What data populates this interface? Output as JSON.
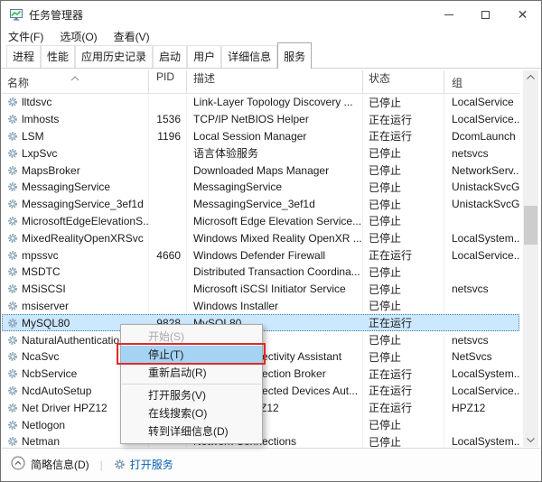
{
  "window": {
    "title": "任务管理器"
  },
  "titlebar_controls": {
    "minimize": "最小化",
    "maximize": "最大化",
    "close": "关闭"
  },
  "menubar": {
    "items": [
      {
        "name": "file",
        "label": "文件(F)"
      },
      {
        "name": "options",
        "label": "选项(O)"
      },
      {
        "name": "view",
        "label": "查看(V)"
      }
    ]
  },
  "tabs": {
    "items": [
      {
        "name": "processes",
        "label": "进程",
        "active": false
      },
      {
        "name": "performance",
        "label": "性能",
        "active": false
      },
      {
        "name": "app-history",
        "label": "应用历史记录",
        "active": false
      },
      {
        "name": "startup",
        "label": "启动",
        "active": false
      },
      {
        "name": "users",
        "label": "用户",
        "active": false
      },
      {
        "name": "details",
        "label": "详细信息",
        "active": false
      },
      {
        "name": "services",
        "label": "服务",
        "active": true
      }
    ]
  },
  "table": {
    "columns": {
      "name": "名称",
      "pid": "PID",
      "desc": "描述",
      "status": "状态",
      "group": "组"
    },
    "rows": [
      {
        "name": "lltdsvc",
        "pid": "",
        "desc": "Link-Layer Topology Discovery ...",
        "status": "已停止",
        "group": "LocalService",
        "selected": false
      },
      {
        "name": "lmhosts",
        "pid": "1536",
        "desc": "TCP/IP NetBIOS Helper",
        "status": "正在运行",
        "group": "LocalService...",
        "selected": false
      },
      {
        "name": "LSM",
        "pid": "1196",
        "desc": "Local Session Manager",
        "status": "正在运行",
        "group": "DcomLaunch",
        "selected": false
      },
      {
        "name": "LxpSvc",
        "pid": "",
        "desc": "语言体验服务",
        "status": "已停止",
        "group": "netsvcs",
        "selected": false
      },
      {
        "name": "MapsBroker",
        "pid": "",
        "desc": "Downloaded Maps Manager",
        "status": "已停止",
        "group": "NetworkServ...",
        "selected": false
      },
      {
        "name": "MessagingService",
        "pid": "",
        "desc": "MessagingService",
        "status": "已停止",
        "group": "UnistackSvcG...",
        "selected": false
      },
      {
        "name": "MessagingService_3ef1d",
        "pid": "",
        "desc": "MessagingService_3ef1d",
        "status": "已停止",
        "group": "UnistackSvcG...",
        "selected": false
      },
      {
        "name": "MicrosoftEdgeElevationS...",
        "pid": "",
        "desc": "Microsoft Edge Elevation Service...",
        "status": "已停止",
        "group": "",
        "selected": false
      },
      {
        "name": "MixedRealityOpenXRSvc",
        "pid": "",
        "desc": "Windows Mixed Reality OpenXR ...",
        "status": "已停止",
        "group": "LocalSystem...",
        "selected": false
      },
      {
        "name": "mpssvc",
        "pid": "4660",
        "desc": "Windows Defender Firewall",
        "status": "正在运行",
        "group": "LocalService...",
        "selected": false
      },
      {
        "name": "MSDTC",
        "pid": "",
        "desc": "Distributed Transaction Coordina...",
        "status": "已停止",
        "group": "",
        "selected": false
      },
      {
        "name": "MSiSCSI",
        "pid": "",
        "desc": "Microsoft iSCSI Initiator Service",
        "status": "已停止",
        "group": "netsvcs",
        "selected": false
      },
      {
        "name": "msiserver",
        "pid": "",
        "desc": "Windows Installer",
        "status": "已停止",
        "group": "",
        "selected": false
      },
      {
        "name": "MySQL80",
        "pid": "9828",
        "desc": "MySQL80",
        "status": "正在运行",
        "group": "",
        "selected": true
      },
      {
        "name": "NaturalAuthentication...",
        "pid": "",
        "desc": "",
        "status": "已停止",
        "group": "netsvcs",
        "selected": false
      },
      {
        "name": "NcaSvc",
        "pid": "",
        "desc": "Network Connectivity Assistant",
        "status": "已停止",
        "group": "NetSvcs",
        "selected": false
      },
      {
        "name": "NcbService",
        "pid": "",
        "desc": "Network Connection Broker",
        "status": "正在运行",
        "group": "LocalSystem...",
        "selected": false
      },
      {
        "name": "NcdAutoSetup",
        "pid": "",
        "desc": "Network Connected Devices Aut...",
        "status": "正在运行",
        "group": "LocalService...",
        "selected": false
      },
      {
        "name": "Net Driver HPZ12",
        "pid": "",
        "desc": "Net Driver HPZ12",
        "status": "正在运行",
        "group": "HPZ12",
        "selected": false
      },
      {
        "name": "Netlogon",
        "pid": "",
        "desc": "",
        "status": "已停止",
        "group": "",
        "selected": false
      },
      {
        "name": "Netman",
        "pid": "",
        "desc": "Network Connections",
        "status": "已停止",
        "group": "LocalSystem...",
        "selected": false
      }
    ]
  },
  "context_menu": {
    "items": [
      {
        "name": "start",
        "label": "开始(S)",
        "disabled": true,
        "highlighted": false,
        "separator": false
      },
      {
        "name": "stop",
        "label": "停止(T)",
        "disabled": false,
        "highlighted": true,
        "separator": false
      },
      {
        "name": "restart",
        "label": "重新启动(R)",
        "disabled": false,
        "highlighted": false,
        "separator": false
      },
      {
        "name": "sep1",
        "label": "",
        "disabled": false,
        "highlighted": false,
        "separator": true
      },
      {
        "name": "open-services",
        "label": "打开服务(V)",
        "disabled": false,
        "highlighted": false,
        "separator": false
      },
      {
        "name": "online-search",
        "label": "在线搜索(O)",
        "disabled": false,
        "highlighted": false,
        "separator": false
      },
      {
        "name": "go-to-details",
        "label": "转到详细信息(D)",
        "disabled": false,
        "highlighted": false,
        "separator": false
      }
    ]
  },
  "footer": {
    "summary_label": "简略信息(D)",
    "open_services_label": "打开服务"
  },
  "colors": {
    "selection_bg": "#cce8ff",
    "menu_highlight": "#a5d3f3",
    "annotation_red": "#e02a2a",
    "link_blue": "#0a60b6",
    "gear_icon": "#84a0b4"
  }
}
